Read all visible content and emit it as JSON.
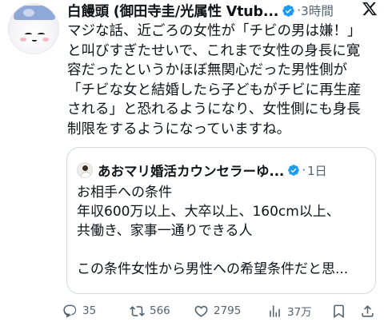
{
  "post": {
    "author_name": "白饅頭 (御田寺圭/光属性 Vtub...",
    "time": "3時間",
    "dot": "·",
    "body_lines": [
      "マジな話、近ごろの女性が「チビの男は嫌！」",
      "と叫びすぎたせいで、これまで女性の身長に寛",
      "容だったというかほぼ無関心だった男性側が",
      "「チビな女と結婚したら子どもがチビに再生産",
      "される」と恐れるようになり、女性側にも身長",
      "制限をするようになっていますね。"
    ]
  },
  "quote": {
    "author_name": "あおマリ婚活カウンセラーゆ...",
    "time": "1日",
    "dot": "·",
    "lines": [
      "お相手への条件",
      "年収600万以上、大卒以上、160cm以上、",
      "共働き、家事一通りできる人",
      "",
      "この条件女性から男性への希望条件だと思..."
    ]
  },
  "actions": {
    "replies": "35",
    "reposts": "566",
    "likes": "2795",
    "views": "37万"
  },
  "icons": {
    "verified": "verified-badge-icon",
    "x_logo": "x-logo-icon",
    "reply": "reply-icon",
    "repost": "repost-icon",
    "like": "heart-icon",
    "views": "views-chart-icon",
    "bookmark": "bookmark-icon",
    "share": "share-icon"
  },
  "colors": {
    "accent": "#1d9bf0",
    "muted": "#536471",
    "border": "#cfd9de"
  }
}
